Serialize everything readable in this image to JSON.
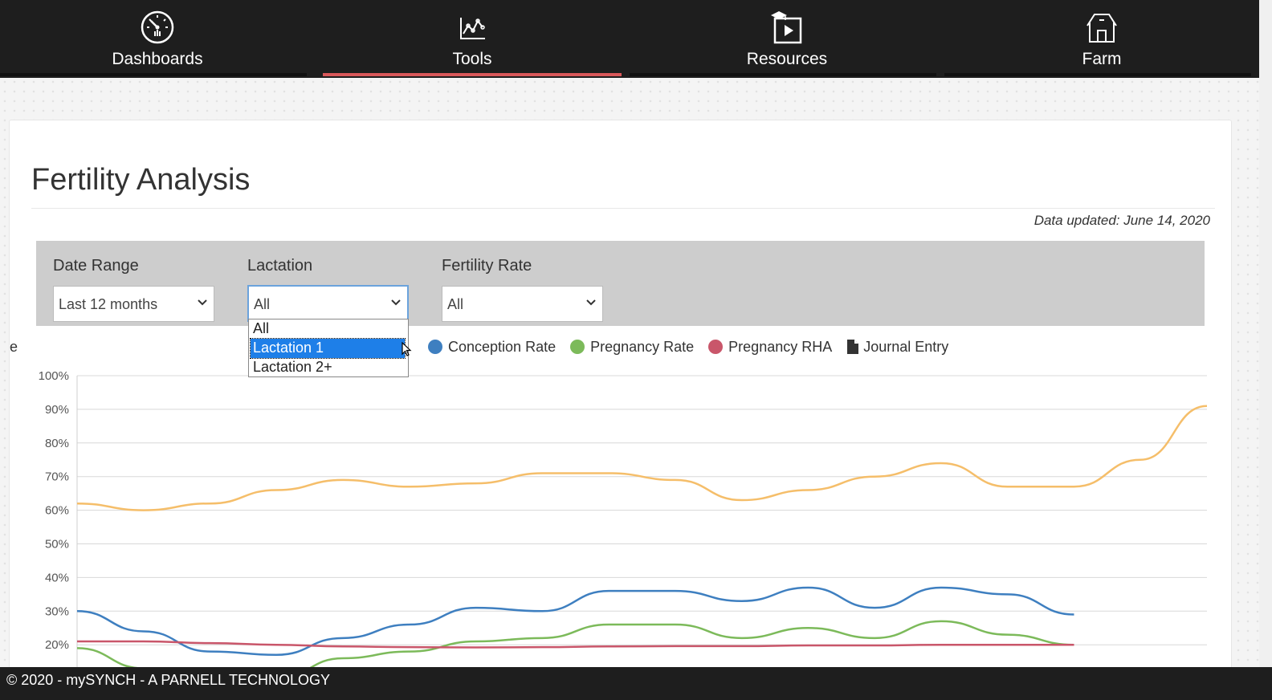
{
  "nav": {
    "items": [
      {
        "label": "Dashboards",
        "icon": "speedometer-icon",
        "active": false
      },
      {
        "label": "Tools",
        "icon": "chart-tools-icon",
        "active": true
      },
      {
        "label": "Resources",
        "icon": "video-resources-icon",
        "active": false
      },
      {
        "label": "Farm",
        "icon": "barn-icon",
        "active": false
      }
    ],
    "active_color": "#d9585a"
  },
  "page": {
    "title": "Fertility Analysis",
    "updated": "Data updated: June 14, 2020"
  },
  "filters": {
    "date_range": {
      "label": "Date Range",
      "value": "Last 12 months"
    },
    "lactation": {
      "label": "Lactation",
      "value": "All",
      "options": [
        "All",
        "Lactation 1",
        "Lactation 2+"
      ],
      "highlighted": "Lactation 1"
    },
    "fertility_rate": {
      "label": "Fertility Rate",
      "value": "All"
    }
  },
  "chart_data": {
    "type": "line",
    "y_ticks": [
      "100%",
      "90%",
      "80%",
      "70%",
      "60%",
      "50%",
      "40%",
      "30%",
      "20%"
    ],
    "ylim": [
      0,
      100
    ],
    "legend": {
      "partial_text": "e",
      "entries": [
        {
          "name": "Conception Rate",
          "color": "#3e7fc0"
        },
        {
          "name": "Pregnancy Rate",
          "color": "#7cba5a"
        },
        {
          "name": "Pregnancy RHA",
          "color": "#c9566a"
        },
        {
          "name": "Journal Entry",
          "icon": "document-icon"
        }
      ]
    },
    "series": [
      {
        "color": "#f5be6a",
        "values": [
          62,
          60,
          62,
          66,
          69,
          67,
          68,
          71,
          71,
          69,
          63,
          66,
          70,
          74,
          67,
          67,
          75,
          91
        ]
      },
      {
        "name": "Conception Rate",
        "color": "#3e7fc0",
        "values": [
          30,
          24,
          18,
          17,
          22,
          26,
          31,
          30,
          36,
          36,
          33,
          37,
          31,
          37,
          35,
          29
        ]
      },
      {
        "name": "Pregnancy Rate",
        "color": "#7cba5a",
        "values": [
          19,
          13,
          10,
          10,
          16,
          18,
          21,
          22,
          26,
          26,
          22,
          25,
          22,
          27,
          23,
          20
        ]
      },
      {
        "name": "Pregnancy RHA",
        "color": "#c9566a",
        "values": [
          21,
          21,
          20.5,
          20,
          19.5,
          19.3,
          19.2,
          19.3,
          19.5,
          19.6,
          19.6,
          19.8,
          19.8,
          20,
          20,
          20
        ]
      }
    ]
  },
  "footer": {
    "text": "© 2020 - mySYNCH - A PARNELL TECHNOLOGY"
  }
}
